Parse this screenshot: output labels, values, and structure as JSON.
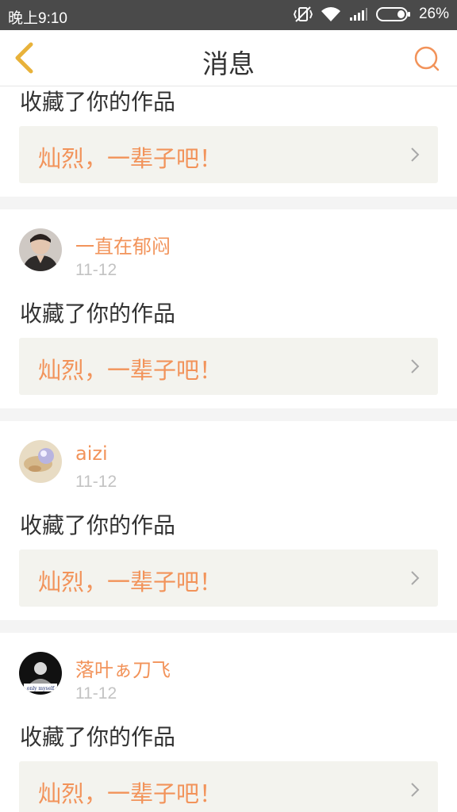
{
  "status_bar": {
    "time": "晚上9:10",
    "battery": "26%",
    "icons": [
      "vibrate-off-icon",
      "wifi-icon",
      "signal-icon",
      "battery-icon"
    ]
  },
  "nav": {
    "title": "消息",
    "back_icon": "chevron-left-icon",
    "search_icon": "search-icon"
  },
  "colors": {
    "accent": "#f2935a",
    "back_arrow": "#e8b23a",
    "status_bar_bg": "#4a4a4a",
    "work_box_bg": "#f3f3ee"
  },
  "notifications": [
    {
      "user": "",
      "date": "",
      "action": "收藏了你的作品",
      "work_title": "灿烈，一辈子吧！"
    },
    {
      "user": "一直在郁闷",
      "date": "11-12",
      "action": "收藏了你的作品",
      "work_title": "灿烈，一辈子吧！"
    },
    {
      "user": "aizi",
      "date": "11-12",
      "action": "收藏了你的作品",
      "work_title": "灿烈，一辈子吧！"
    },
    {
      "user": "落叶ぁ刀飞",
      "date": "11-12",
      "action": "收藏了你的作品",
      "work_title": "灿烈，一辈子吧！",
      "avatar_caption": "only myself"
    }
  ]
}
